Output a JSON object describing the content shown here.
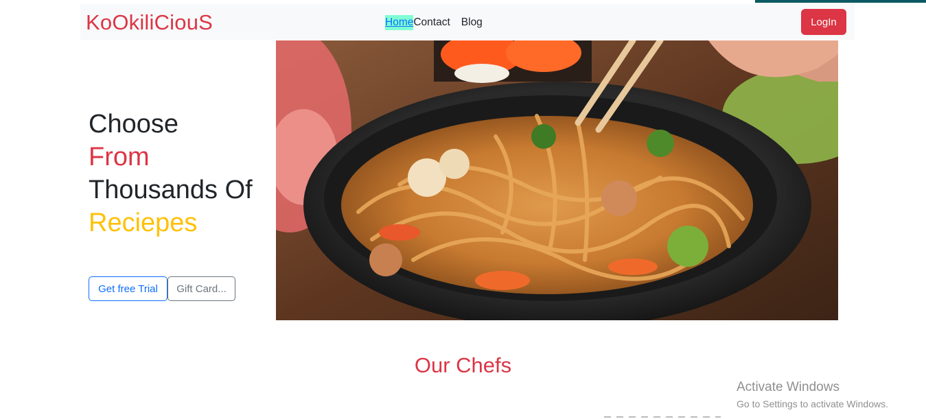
{
  "brand": {
    "name": "KoOkiliCiouS"
  },
  "nav": {
    "items": [
      {
        "label": "Home",
        "active": true
      },
      {
        "label": "Contact",
        "active": false
      },
      {
        "label": "Blog",
        "active": false
      }
    ],
    "login_label": "LogIn"
  },
  "hero": {
    "line1": "Choose",
    "line2": "From",
    "line3": "Thousands Of",
    "line4": "Reciepes",
    "primary_button": "Get free Trial",
    "secondary_button": "Gift Card..."
  },
  "section": {
    "title": "Our Chefs"
  },
  "watermark": {
    "title": "Activate Windows",
    "subtitle": "Go to Settings to activate Windows."
  },
  "colors": {
    "brand_red": "#dc3545",
    "accent_yellow": "#ffc107",
    "active_link_bg": "#7fffd4",
    "navbar_bg": "#f8f9fa"
  }
}
